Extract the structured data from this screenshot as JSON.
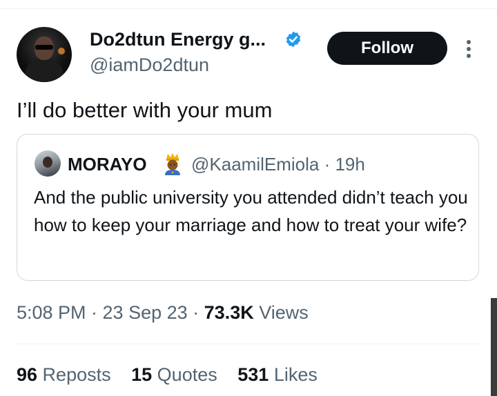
{
  "author": {
    "display_name": "Do2dtun Energy g...",
    "handle": "@iamDo2dtun",
    "verified": true
  },
  "follow_label": "Follow",
  "tweet_text": "I’ll do better with your mum",
  "quote": {
    "name": "MORAYO",
    "emoji": "man-with-crown",
    "handle_time": "@KaamilEmiola · 19h",
    "text": "And the public university you attended didn’t teach you how to keep your marriage and how to treat your wife?"
  },
  "meta": {
    "time_date": "5:08 PM · 23 Sep 23 · ",
    "views_count": "73.3K",
    "views_label": " Views"
  },
  "stats": [
    {
      "count": "96",
      "label": " Reposts"
    },
    {
      "count": "15",
      "label": " Quotes"
    },
    {
      "count": "531",
      "label": " Likes"
    }
  ],
  "colors": {
    "text": "#0f1419",
    "secondary": "#536471",
    "verified": "#1d9bf0",
    "border": "#cfd9de"
  }
}
